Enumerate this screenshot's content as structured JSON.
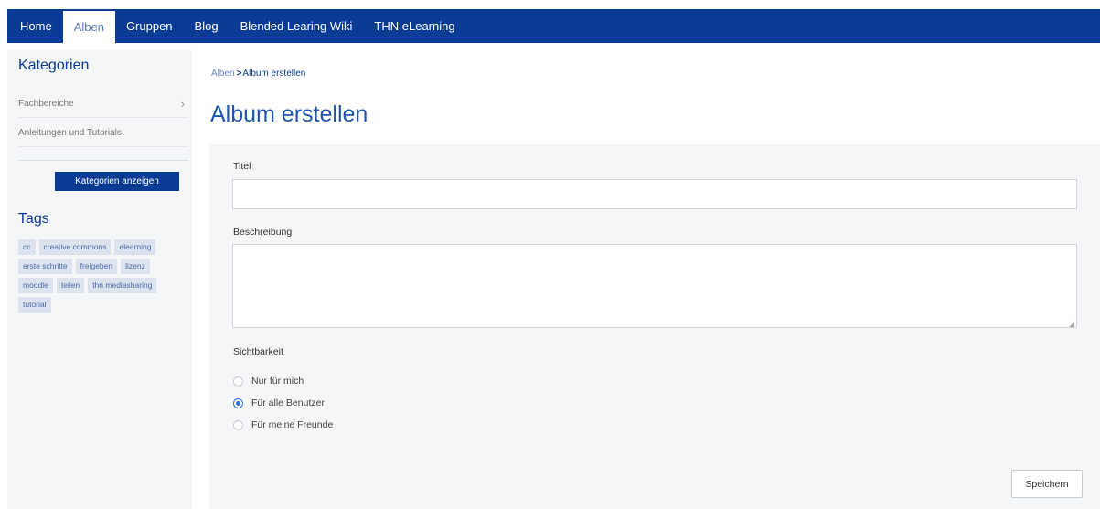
{
  "nav": {
    "items": [
      {
        "label": "Home"
      },
      {
        "label": "Alben"
      },
      {
        "label": "Gruppen"
      },
      {
        "label": "Blog"
      },
      {
        "label": "Blended Learing Wiki"
      },
      {
        "label": "THN eLearning"
      }
    ],
    "active": "Alben"
  },
  "sidebar": {
    "categories_heading": "Kategorien",
    "categories": [
      {
        "label": "Fachbereiche",
        "has_children": true
      },
      {
        "label": "Anleitungen und Tutorials",
        "has_children": false
      }
    ],
    "show_categories_button": "Kategorien anzeigen",
    "tags_heading": "Tags",
    "tags": [
      "cc",
      "creative commons",
      "elearning",
      "erste schritte",
      "freigeben",
      "lizenz",
      "moodle",
      "teilen",
      "thn mediasharing",
      "tutorial"
    ]
  },
  "breadcrumb": {
    "parent": "Alben",
    "separator": ">",
    "current": "Album erstellen"
  },
  "page_title": "Album erstellen",
  "form": {
    "title_label": "Titel",
    "title_value": "",
    "description_label": "Beschreibung",
    "description_value": "",
    "visibility_label": "Sichtbarkeit",
    "visibility_options": [
      {
        "label": "Nur für mich",
        "checked": false
      },
      {
        "label": "Für alle Benutzer",
        "checked": true
      },
      {
        "label": "Für meine Freunde",
        "checked": false
      }
    ],
    "save_label": "Speichern"
  },
  "colors": {
    "brand": "#0a3c96",
    "title": "#1f56ad",
    "panel": "#f4f5f7",
    "radio_checked": "#2f72e0"
  }
}
